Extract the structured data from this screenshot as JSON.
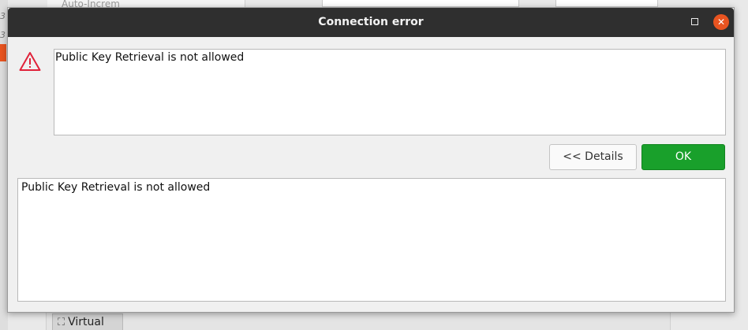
{
  "background": {
    "left_texts": [
      "3",
      "3"
    ],
    "top_label": "Auto-Increm",
    "bottom_tab_label": "Virtual"
  },
  "dialog": {
    "title": "Connection error",
    "message": "Public Key Retrieval is not allowed",
    "details_button_label": "<< Details",
    "ok_button_label": "OK",
    "details_text": "Public Key Retrieval is not allowed",
    "close_glyph": "✕"
  },
  "colors": {
    "titlebar": "#2f2f2f",
    "close": "#e95420",
    "ok": "#19a02b",
    "warning": "#e0223a"
  },
  "icons": {
    "warning": "warning-triangle-icon",
    "maximize": "maximize-icon",
    "close": "close-icon",
    "virtual": "virtual-node-icon"
  }
}
